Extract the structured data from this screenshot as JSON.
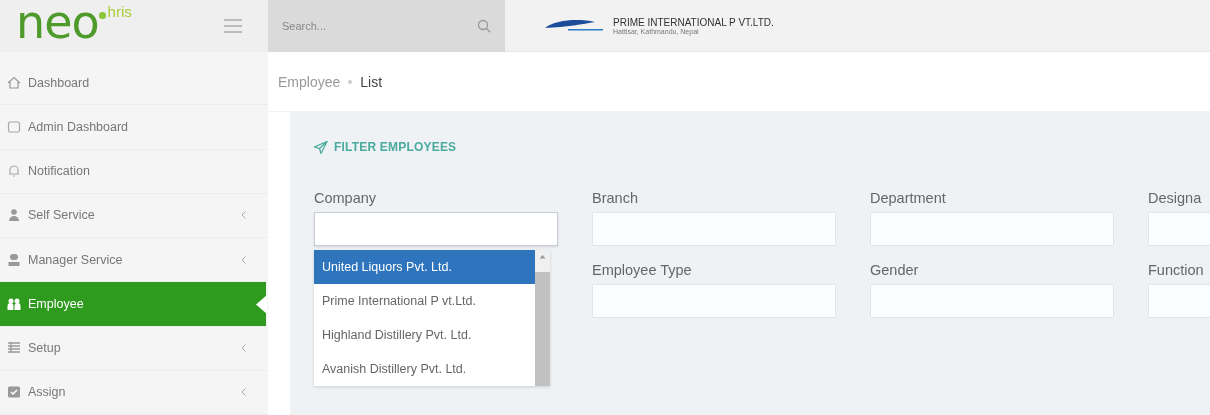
{
  "logo": {
    "name": "neo",
    "suffix": "hris"
  },
  "search": {
    "placeholder": "Search..."
  },
  "company": {
    "name": "PRIME INTERNATIONAL P VT.LTD.",
    "address": "Hattisar, Kathmandu, Nepal"
  },
  "sidebar": {
    "items": [
      {
        "label": "Dashboard",
        "expandable": false,
        "selected": false
      },
      {
        "label": "Admin Dashboard",
        "expandable": false,
        "selected": false
      },
      {
        "label": "Notification",
        "expandable": false,
        "selected": false
      },
      {
        "label": "Self Service",
        "expandable": true,
        "selected": false
      },
      {
        "label": "Manager Service",
        "expandable": true,
        "selected": false
      },
      {
        "label": "Employee",
        "expandable": false,
        "selected": true
      },
      {
        "label": "Setup",
        "expandable": true,
        "selected": false
      },
      {
        "label": "Assign",
        "expandable": true,
        "selected": false
      }
    ]
  },
  "breadcrumb": [
    "Employee",
    "List"
  ],
  "filter": {
    "title": "FILTER EMPLOYEES",
    "rows": [
      [
        {
          "label": "Company",
          "open": true,
          "options": [
            {
              "label": "United Liquors Pvt. Ltd.",
              "selected": true
            },
            {
              "label": "Prime International P vt.Ltd.",
              "selected": false
            },
            {
              "label": "Highland Distillery Pvt. Ltd.",
              "selected": false
            },
            {
              "label": "Avanish Distillery Pvt. Ltd.",
              "selected": false
            }
          ]
        },
        {
          "label": "Branch"
        },
        {
          "label": "Department"
        },
        {
          "label": "Designa"
        }
      ],
      [
        "",
        {
          "label": "Employee Type"
        },
        {
          "label": "Gender"
        },
        {
          "label": "Function"
        }
      ]
    ]
  }
}
